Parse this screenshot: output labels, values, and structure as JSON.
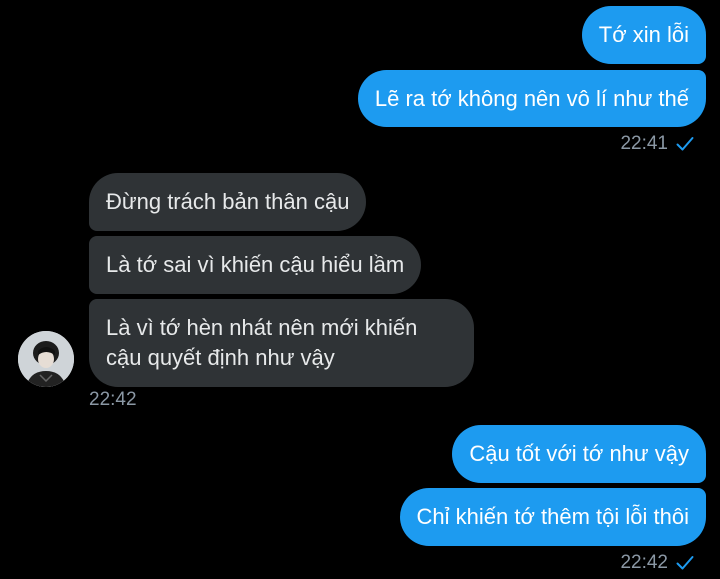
{
  "conversation": {
    "group1": {
      "messages": [
        "Tớ xin lỗi",
        "Lẽ ra tớ không nên vô lí như thế"
      ],
      "time": "22:41"
    },
    "group2": {
      "messages": [
        "Đừng trách bản thân cậu",
        "Là tớ sai vì khiến cậu hiểu lầm",
        "Là vì tớ hèn nhát nên mới khiến cậu quyết định như vậy"
      ],
      "time": "22:42"
    },
    "group3": {
      "messages": [
        "Cậu tốt với tớ như vậy",
        "Chỉ khiến tớ thêm tội lỗi thôi"
      ],
      "time": "22:42"
    }
  },
  "colors": {
    "outgoing_bubble": "#1d9bf0",
    "incoming_bubble": "#2f3336",
    "background": "#000000",
    "timestamp": "#8b98a5",
    "read_check": "#1d9bf0"
  },
  "icons": {
    "read_receipt": "check-icon",
    "sender_avatar": "avatar"
  }
}
